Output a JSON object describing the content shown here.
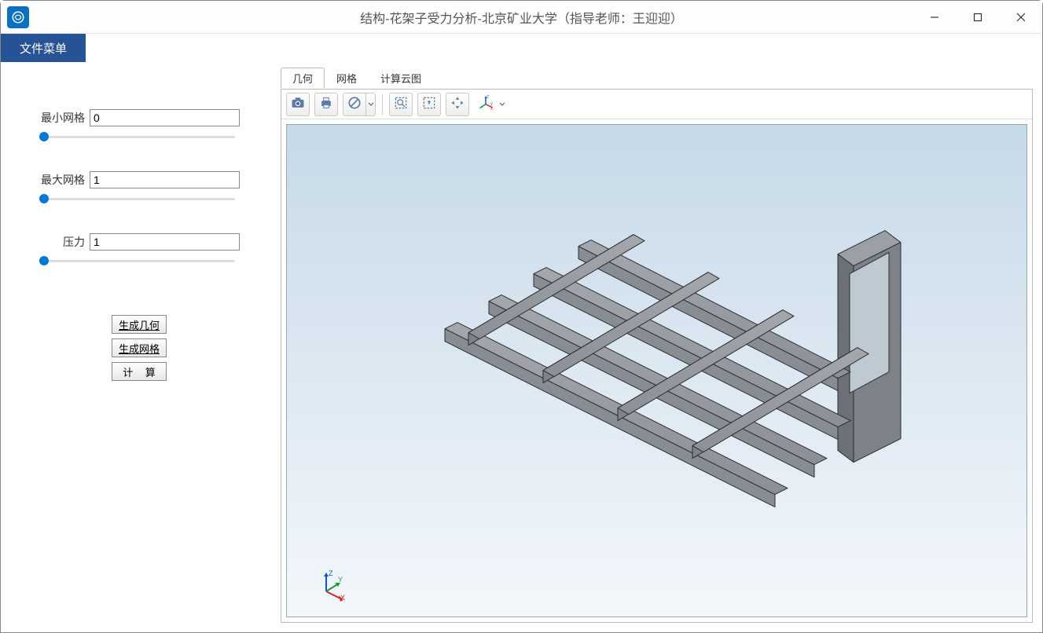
{
  "window": {
    "title": "结构-花架子受力分析-北京矿业大学（指导老师：王迎迎）"
  },
  "menubar": {
    "file": "文件菜单"
  },
  "params": {
    "min_mesh": {
      "label": "最小网格",
      "value": "0"
    },
    "max_mesh": {
      "label": "最大网格",
      "value": "1"
    },
    "pressure": {
      "label": "压力",
      "value": "1"
    }
  },
  "buttons": {
    "gen_geometry": "生成几何",
    "gen_mesh": "生成网格",
    "compute": "计 算"
  },
  "tabs": {
    "geometry": "几何",
    "mesh": "网格",
    "cloud": "计算云图"
  }
}
